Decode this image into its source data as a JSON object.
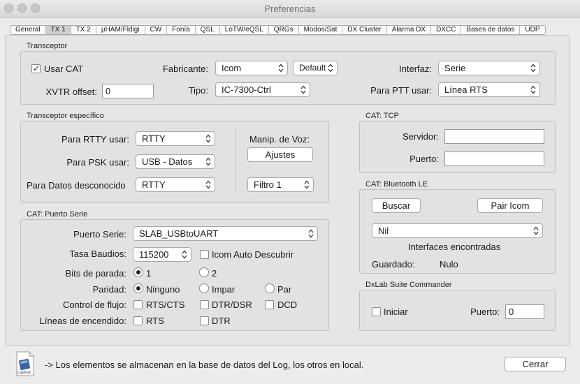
{
  "window": {
    "title": "Preferencias"
  },
  "tabs": [
    "General",
    "TX 1",
    "TX 2",
    "µHAM/Fldigi",
    "CW",
    "Fonía",
    "QSL",
    "LoTW/eQSL",
    "QRGs",
    "Modos/Sat",
    "DX Cluster",
    "Alarma DX",
    "DXCC",
    "Bases de datos",
    "UDP"
  ],
  "active_tab": "TX 1",
  "transceptor": {
    "group_label": "Transceptor",
    "usar_cat_label": "Usar CAT",
    "usar_cat_checked": true,
    "fabricante_label": "Fabricante:",
    "fabricante_value": "Icom",
    "default_label": "Default",
    "interfaz_label": "Interfaz:",
    "interfaz_value": "Serie",
    "xvtr_label": "XVTR offset:",
    "xvtr_value": "0",
    "tipo_label": "Tipo:",
    "tipo_value": "IC-7300-Ctrl",
    "ptt_label": "Para PTT usar:",
    "ptt_value": "Línea RTS"
  },
  "especifico": {
    "group_label": "Transceptor específico",
    "rtty_label": "Para RTTY usar:",
    "rtty_value": "RTTY",
    "psk_label": "Para PSK usar:",
    "psk_value": "USB - Datos",
    "datos_label": "Para Datos desconocido",
    "datos_value": "RTTY",
    "manip_label": "Manip. de Voz:",
    "ajustes_label": "Ajustes",
    "filtro_value": "Filtro 1"
  },
  "serie": {
    "group_label": "CAT: Puerto Serie",
    "puerto_label": "Puerto Serie:",
    "puerto_value": "SLAB_USBtoUART",
    "baud_label": "Tasa Baudios:",
    "baud_value": "115200",
    "autodesc_label": "Icom Auto Descubrir",
    "bits_label": "Bits de parada:",
    "bits_1": "1",
    "bits_2": "2",
    "paridad_label": "Paridad:",
    "par_ninguno": "Ninguno",
    "par_impar": "Impar",
    "par_par": "Par",
    "flujo_label": "Control de flujo:",
    "rtscts": "RTS/CTS",
    "dtrdsr": "DTR/DSR",
    "dcd": "DCD",
    "encendido_label": "Líneas de encendido:",
    "rts": "RTS",
    "dtr": "DTR"
  },
  "tcp": {
    "group_label": "CAT: TCP",
    "servidor_label": "Servidor:",
    "servidor_value": "",
    "puerto_label": "Puerto:",
    "puerto_value": ""
  },
  "bluetooth": {
    "group_label": "CAT: Bluetooth LE",
    "buscar_label": "Buscar",
    "pair_label": "Pair Icom",
    "device_value": "Nil",
    "interfaces_label": "Interfaces encontradas",
    "guardado_label": "Guardado:",
    "guardado_value": "Nulo"
  },
  "dxlab": {
    "group_label": "DxLab Suite Commander",
    "iniciar_label": "Iniciar",
    "puerto_label": "Puerto:",
    "puerto_value": "0"
  },
  "footer": {
    "logo_text": "Logbook",
    "note": "-> Los elementos se almacenan en la base de datos del Log, los otros en local.",
    "cerrar_label": "Cerrar"
  }
}
